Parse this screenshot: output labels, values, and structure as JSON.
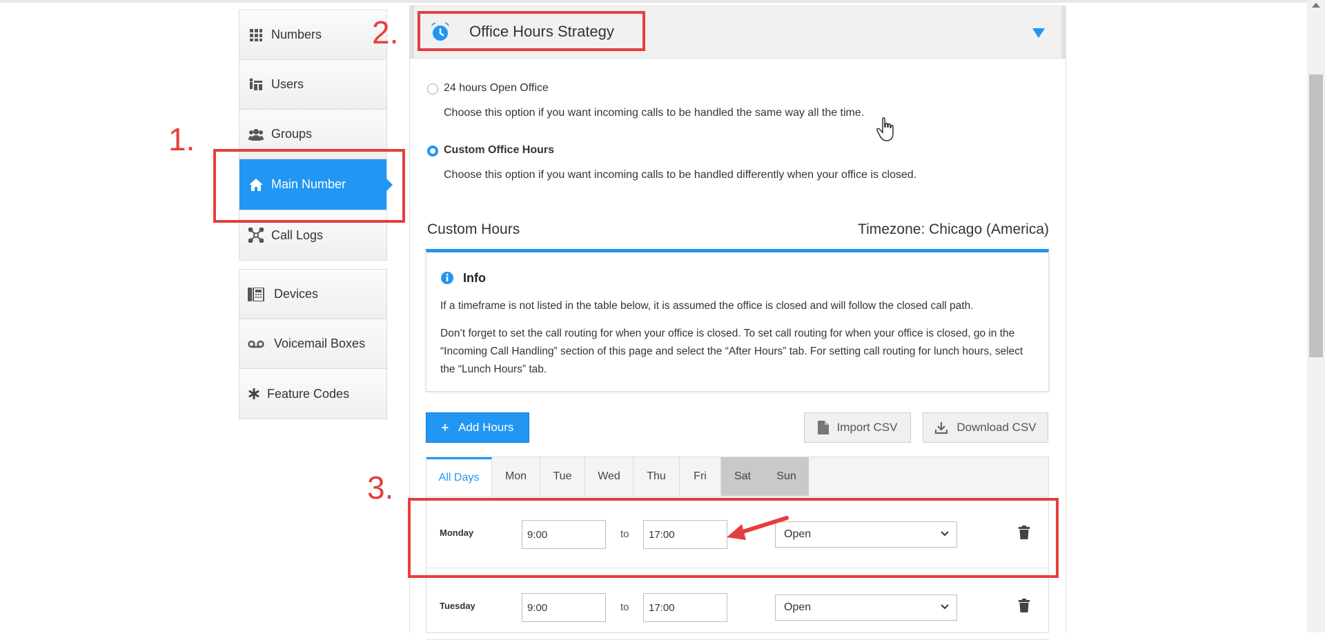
{
  "sidebar": {
    "groups": [
      [
        {
          "label": "Numbers",
          "icon": "grid-icon"
        },
        {
          "label": "Users",
          "icon": "users-icon"
        },
        {
          "label": "Groups",
          "icon": "group-icon"
        },
        {
          "label": "Main Number",
          "icon": "home-icon",
          "active": true
        },
        {
          "label": "Call Logs",
          "icon": "network-icon"
        }
      ],
      [
        {
          "label": "Devices",
          "icon": "phone-device-icon"
        },
        {
          "label": "Voicemail Boxes",
          "icon": "voicemail-icon"
        },
        {
          "label": "Feature Codes",
          "icon": "asterisk-icon"
        }
      ]
    ]
  },
  "annotations": {
    "step1": "1.",
    "step2": "2.",
    "step3": "3.",
    "color": "#e53e3e"
  },
  "panel": {
    "title": "Office Hours Strategy",
    "options": [
      {
        "label": "24 hours Open Office",
        "description": "Choose this option if you want incoming calls to be handled the same way all the time.",
        "checked": false
      },
      {
        "label": "Custom Office Hours",
        "description": "Choose this option if you want incoming calls to be handled differently when your office is closed.",
        "checked": true
      }
    ],
    "custom_hours_title": "Custom Hours",
    "timezone": "Timezone: Chicago (America)",
    "info": {
      "title": "Info",
      "p1": "If a timeframe is not listed in the table below, it is assumed the office is closed and will follow the closed call path.",
      "p2": "Don’t forget to set the call routing for when your office is closed. To set call routing for when your office is closed, go in the “Incoming Call Handling” section of this page and select the “After Hours” tab. For setting call routing for lunch hours, select the “Lunch Hours” tab."
    },
    "buttons": {
      "add": "Add Hours",
      "import": "Import CSV",
      "download": "Download CSV"
    },
    "tabs": [
      "All Days",
      "Mon",
      "Tue",
      "Wed",
      "Thu",
      "Fri",
      "Sat",
      "Sun"
    ],
    "rows": [
      {
        "day": "Monday",
        "from": "9:00",
        "to_label": "to",
        "to": "17:00",
        "status": "Open"
      },
      {
        "day": "Tuesday",
        "from": "9:00",
        "to_label": "to",
        "to": "17:00",
        "status": "Open"
      }
    ]
  },
  "colors": {
    "accent": "#2196f3",
    "annotation": "#e53e3e"
  }
}
